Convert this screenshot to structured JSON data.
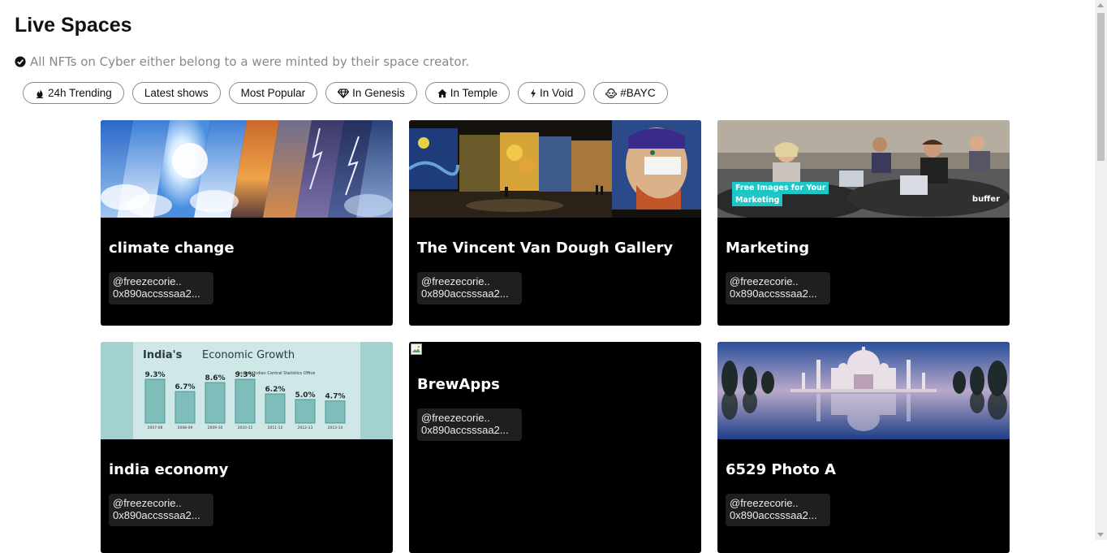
{
  "header": {
    "title": "Live Spaces",
    "subtitle": "All NFTs on Cyber either belong to a were minted by their space creator."
  },
  "filters": [
    {
      "label": "24h Trending",
      "icon": "flame-icon"
    },
    {
      "label": "Latest shows",
      "icon": ""
    },
    {
      "label": "Most Popular",
      "icon": ""
    },
    {
      "label": "In Genesis",
      "icon": "gem-icon"
    },
    {
      "label": "In Temple",
      "icon": "home-icon"
    },
    {
      "label": "In Void",
      "icon": "bolt-icon"
    },
    {
      "label": "#BAYC",
      "icon": "ape-icon"
    }
  ],
  "cards": [
    {
      "name": "climate change",
      "owner_handle": "@freezecorie..",
      "owner_address": "0x890accsssaa2...",
      "thumb": "weather-collage-image"
    },
    {
      "name": "The Vincent Van Dough Gallery",
      "owner_handle": "@freezecorie..",
      "owner_address": "0x890accsssaa2...",
      "thumb": "van-gogh-exhibit-image"
    },
    {
      "name": "Marketing",
      "owner_handle": "@freezecorie..",
      "owner_address": "0x890accsssaa2...",
      "thumb": "marketing-meeting-image",
      "thumb_caption": [
        "Free Images for Your",
        "Marketing"
      ],
      "thumb_brand": "buffer"
    },
    {
      "name": "india economy",
      "owner_handle": "@freezecorie..",
      "owner_address": "0x890accsssaa2...",
      "thumb": "economic-growth-chart-image",
      "thumb_chart": {
        "title_bold": "India's",
        "title_rest": "Economic Growth",
        "source": "Source: Indian Central Statistics Office",
        "values": [
          "9.3%",
          "6.7%",
          "8.6%",
          "9.3%",
          "6.2%",
          "5.0%",
          "4.7%"
        ],
        "years": [
          "2007-08",
          "2008-09",
          "2009-10",
          "2010-11",
          "2011-12",
          "2012-13",
          "2013-14"
        ]
      }
    },
    {
      "name": "BrewApps",
      "owner_handle": "@freezecorie..",
      "owner_address": "0x890accsssaa2...",
      "thumb": "broken-image"
    },
    {
      "name": "6529 Photo A",
      "owner_handle": "@freezecorie..",
      "owner_address": "0x890accsssaa2...",
      "thumb": "taj-mahal-image"
    }
  ],
  "colors": {
    "card_bg": "#000000",
    "chip_border": "#8a8a8a",
    "subtitle": "#888888",
    "teal_caption": "#1ec6c6"
  }
}
